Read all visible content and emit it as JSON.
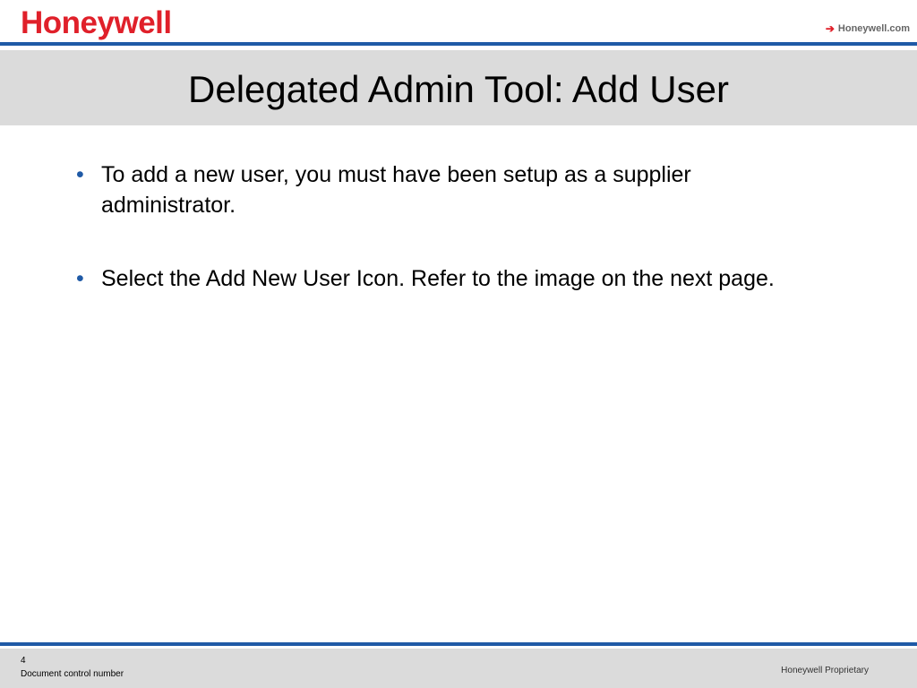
{
  "header": {
    "logo_text": "Honeywell",
    "site_link": "Honeywell.com",
    "site_link_icon": "arrow-right-icon",
    "brand_color": "#e0202a",
    "rule_color": "#1f5aa6"
  },
  "slide": {
    "title": "Delegated Admin Tool:  Add User",
    "bullets": [
      "To add a new user, you must have been setup as a supplier administrator.",
      "Select the Add New User Icon. Refer to the image on the next page."
    ]
  },
  "footer": {
    "page_number": "4",
    "document_control": "Document control number",
    "proprietary": "Honeywell Proprietary"
  }
}
